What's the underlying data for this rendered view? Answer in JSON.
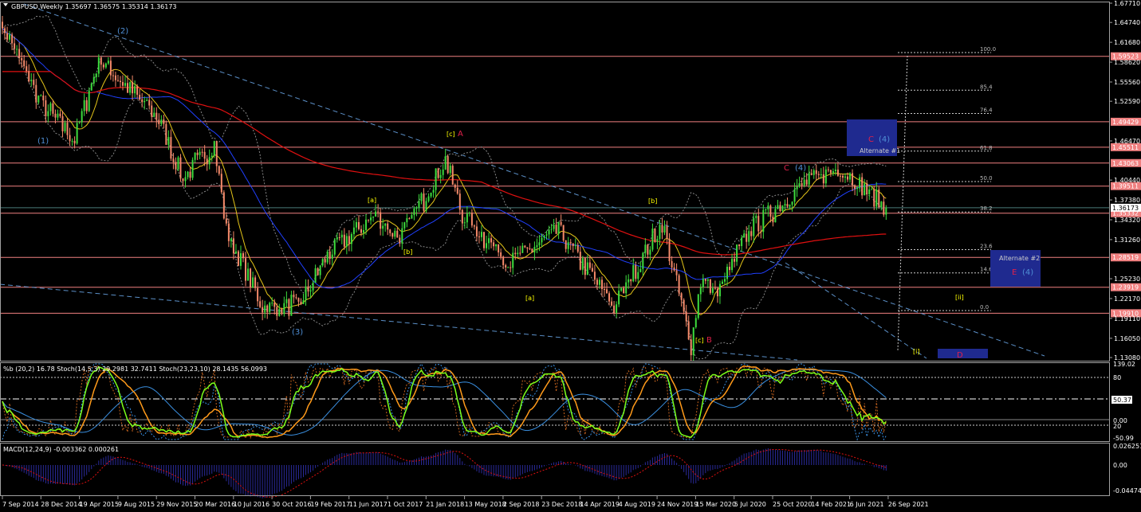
{
  "window": {
    "symbol": "GBPUSD",
    "timeframe": "Weekly",
    "header": "GBPUSD,Weekly  1.35697 1.36575 1.35314 1.36173"
  },
  "colors": {
    "bull": "#3ddc3d",
    "bear": "#f58a6a",
    "level": "#f08080",
    "ma_fast": "#e6c619",
    "ma_mid": "#2040ff",
    "ma_slow": "#e01010",
    "trend": "#5b8fc7",
    "box": "#1f2a8f",
    "wave_blue": "#4f8fd6",
    "wave_red": "#e0204a",
    "wave_yellow": "#ffff00"
  },
  "chart_data": {
    "type": "candlestick",
    "title": "GBPUSD,Weekly",
    "last_bar": {
      "open": 1.35697,
      "high": 1.36575,
      "low": 1.35314,
      "close": 1.36173
    },
    "bars": 368,
    "ylim": [
      1.1308,
      1.6771
    ],
    "y_ticks": [
      "1.67710",
      "1.64740",
      "1.61680",
      "1.58620",
      "1.55560",
      "1.52590",
      "1.46470",
      "1.40440",
      "1.37380",
      "1.34320",
      "1.31260",
      "1.25230",
      "1.22170",
      "1.19110",
      "1.16050",
      "1.13080"
    ],
    "x_ticks": [
      "7 Sep 2014",
      "28 Dec 2014",
      "19 Apr 2015",
      "9 Aug 2015",
      "29 Nov 2015",
      "20 Mar 2016",
      "10 Jul 2016",
      "30 Oct 2016",
      "19 Feb 2017",
      "11 Jun 2017",
      "1 Oct 2017",
      "21 Jan 2018",
      "13 May 2018",
      "2 Sep 2018",
      "23 Dec 2018",
      "14 Apr 2019",
      "4 Aug 2019",
      "24 Nov 2019",
      "15 Mar 2020",
      "5 Jul 2020",
      "25 Oct 2020",
      "14 Feb 2021",
      "6 Jun 2021",
      "26 Sep 2021"
    ],
    "swing_points": [
      [
        0,
        1.645
      ],
      [
        16,
        1.522
      ],
      [
        30,
        1.467
      ],
      [
        40,
        1.59
      ],
      [
        52,
        1.547
      ],
      [
        65,
        1.498
      ],
      [
        75,
        1.406
      ],
      [
        88,
        1.461
      ],
      [
        93,
        1.326
      ],
      [
        108,
        1.209
      ],
      [
        123,
        1.209
      ],
      [
        135,
        1.289
      ],
      [
        155,
        1.351
      ],
      [
        165,
        1.314
      ],
      [
        184,
        1.436
      ],
      [
        191,
        1.351
      ],
      [
        211,
        1.277
      ],
      [
        231,
        1.326
      ],
      [
        254,
        1.209
      ],
      [
        274,
        1.338
      ],
      [
        286,
        1.148
      ],
      [
        290,
        1.252
      ],
      [
        297,
        1.228
      ],
      [
        310,
        1.326
      ],
      [
        333,
        1.399
      ],
      [
        348,
        1.424
      ],
      [
        367,
        1.36173
      ]
    ],
    "horizontal_levels": [
      "1.59523",
      "1.49429",
      "1.45511",
      "1.43063",
      "1.39511",
      "1.35332",
      "1.28519",
      "1.23919",
      "1.19910"
    ],
    "current_price": "1.36173",
    "fib_levels": [
      "100.0",
      "85.4",
      "76.4",
      "61.8",
      "50.0",
      "38.2",
      "23.6",
      "14.6",
      "0.0"
    ],
    "wave_labels": [
      {
        "text": "(2)",
        "color": "blue"
      },
      {
        "text": "(1)",
        "color": "blue"
      },
      {
        "text": "(3)",
        "color": "blue"
      },
      {
        "text": "[c]",
        "color": "yellow"
      },
      {
        "text": "A",
        "color": "red"
      },
      {
        "text": "[a]",
        "color": "yellow"
      },
      {
        "text": "[b]",
        "color": "yellow"
      },
      {
        "text": "[b]",
        "color": "yellow"
      },
      {
        "text": "[a]",
        "color": "yellow"
      },
      {
        "text": "[c]",
        "color": "yellow"
      },
      {
        "text": "B",
        "color": "red"
      },
      {
        "text": "C",
        "color": "red"
      },
      {
        "text": "(4)",
        "color": "blue"
      },
      {
        "text": "[ii]",
        "color": "yellow"
      },
      {
        "text": "[i]",
        "color": "yellow"
      }
    ],
    "boxes": [
      {
        "title": "Alternate #1",
        "wave": "C",
        "degree": "(4)"
      },
      {
        "title": "Alternate #2",
        "wave": "E",
        "degree": "(4)"
      },
      {
        "title": "",
        "wave": "D",
        "degree": ""
      }
    ],
    "indicators": {
      "osc_label": "%b (20,2) 16.78  Stoch(14,5,3) 29.2981 32.7411  Stoch(23,23,10) 28.1435 56.0993",
      "osc_ticks": [
        "139.02",
        "80",
        "50.37",
        "0.00",
        "20",
        "-50.99"
      ],
      "macd_label": "MACD(12,24,9) -0.003362 0.000261",
      "macd_ticks": [
        "0.026251",
        "0.00",
        "-0.044743"
      ]
    }
  }
}
